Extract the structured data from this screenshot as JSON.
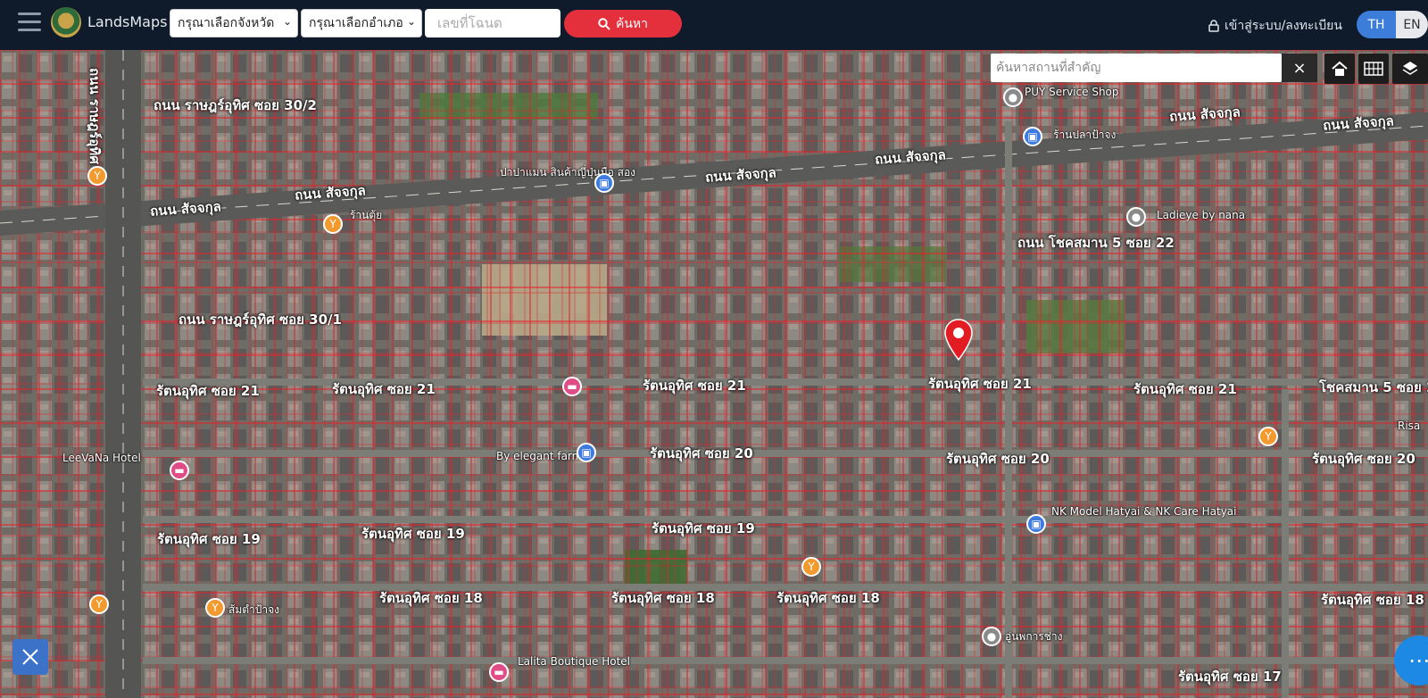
{
  "header": {
    "brand": "LandsMaps",
    "province_select": "กรุณาเลือกจังหวัด",
    "district_select": "กรุณาเลือกอำเภอ",
    "deed_placeholder": "เลขที่โฉนด",
    "search_label": "ค้นหา",
    "login_label": "เข้าสู่ระบบ/ลงทะเบียน",
    "lang_th": "TH",
    "lang_en": "EN"
  },
  "map": {
    "place_search_placeholder": "ค้นหาสถานที่สำคัญ",
    "clear_label": "×",
    "roads": [
      {
        "label": "ถนน สัจจกุล"
      },
      {
        "label": "ถนน สัจจกุล"
      },
      {
        "label": "ถนน สัจจกุล"
      },
      {
        "label": "ถนน สัจจกุล"
      },
      {
        "label": "ถนน สัจจกุล"
      },
      {
        "label": "ถนน สัจจกุล"
      },
      {
        "label": "ถนน ราษฎร์อุทิศ ซอย 30/1"
      },
      {
        "label": "ถนน ราษฎร์อุทิศ ซอย 30/2"
      },
      {
        "label": "รัตนอุทิศ ซอย 21"
      },
      {
        "label": "รัตนอุทิศ ซอย 21"
      },
      {
        "label": "รัตนอุทิศ ซอย 21"
      },
      {
        "label": "รัตนอุทิศ ซอย 21"
      },
      {
        "label": "รัตนอุทิศ ซอย 21"
      },
      {
        "label": "รัตนอุทิศ ซอย 20"
      },
      {
        "label": "รัตนอุทิศ ซอย 20"
      },
      {
        "label": "รัตนอุทิศ ซอย 20"
      },
      {
        "label": "รัตนอุทิศ ซอย 19"
      },
      {
        "label": "รัตนอุทิศ ซอย 19"
      },
      {
        "label": "รัตนอุทิศ ซอย 19"
      },
      {
        "label": "รัตนอุทิศ ซอย 18"
      },
      {
        "label": "รัตนอุทิศ ซอย 18"
      },
      {
        "label": "รัตนอุทิศ ซอย 18"
      },
      {
        "label": "รัตนอุทิศ ซอย 18"
      },
      {
        "label": "รัตนอุทิศ ซอย 17"
      },
      {
        "label": "ถนน โชคสมาน 5 ซอย 22"
      },
      {
        "label": "โชคสมาน 5 ซอย 2"
      },
      {
        "label": "ถนน ราษฎร์อุทิศ"
      }
    ],
    "pois": [
      {
        "label": "PUY Service Shop"
      },
      {
        "label": "ร้านปลาป้าจง"
      },
      {
        "label": "ปาปาแมน สินค้าญี่ปุ่นมือ สอง"
      },
      {
        "label": "ร้านตุ้ย"
      },
      {
        "label": "Ladieye by nana"
      },
      {
        "label": "LeeVaNa Hotel"
      },
      {
        "label": "By elegant farm"
      },
      {
        "label": "NK Model Hatyai & NK Care Hatyai"
      },
      {
        "label": "ส้มตำป้าจง"
      },
      {
        "label": "Lalita Boutique Hotel"
      },
      {
        "label": "อู่นพการช่าง"
      },
      {
        "label": "Risa"
      }
    ]
  }
}
